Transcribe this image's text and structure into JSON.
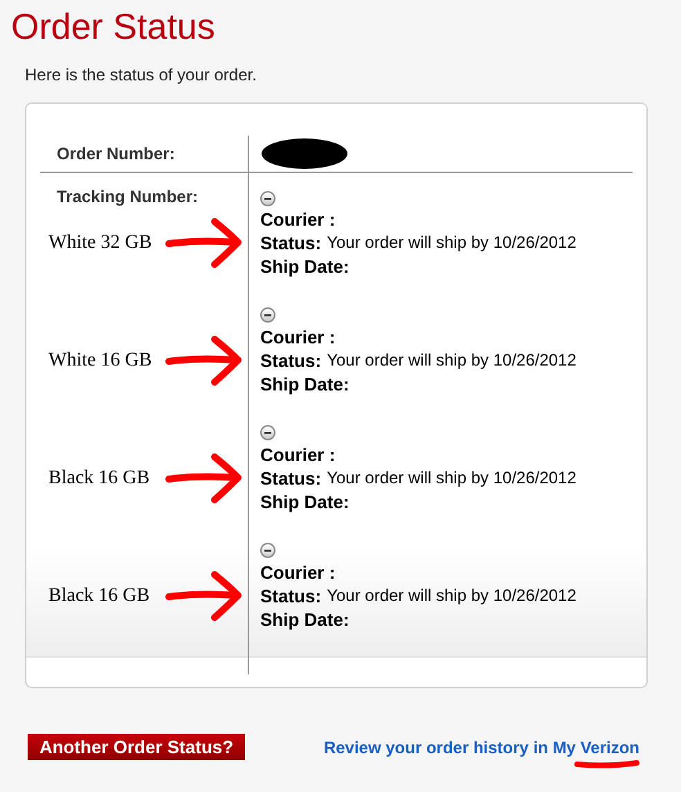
{
  "title": "Order Status",
  "intro": "Here is the status of your order.",
  "order": {
    "number_label": "Order Number:",
    "number_redacted": true,
    "tracking_label": "Tracking Number:"
  },
  "items": [
    {
      "note": "White 32 GB",
      "expanded": true,
      "courier_label": "Courier :",
      "status_label": "Status:",
      "status_text": "Your order will ship by 10/26/2012",
      "ship_date_label": "Ship Date:"
    },
    {
      "note": "White 16 GB",
      "expanded": true,
      "courier_label": "Courier :",
      "status_label": "Status:",
      "status_text": "Your order will ship by 10/26/2012",
      "ship_date_label": "Ship Date:"
    },
    {
      "note": "Black 16 GB",
      "expanded": true,
      "courier_label": "Courier :",
      "status_label": "Status:",
      "status_text": "Your order will ship by 10/26/2012",
      "ship_date_label": "Ship Date:"
    },
    {
      "note": "Black 16 GB",
      "expanded": true,
      "courier_label": "Courier :",
      "status_label": "Status:",
      "status_text": "Your order will ship by 10/26/2012",
      "ship_date_label": "Ship Date:"
    }
  ],
  "footer": {
    "button": "Another Order Status?",
    "link": "Review your order history in My Verizon",
    "link_underlined_annotation": true
  }
}
